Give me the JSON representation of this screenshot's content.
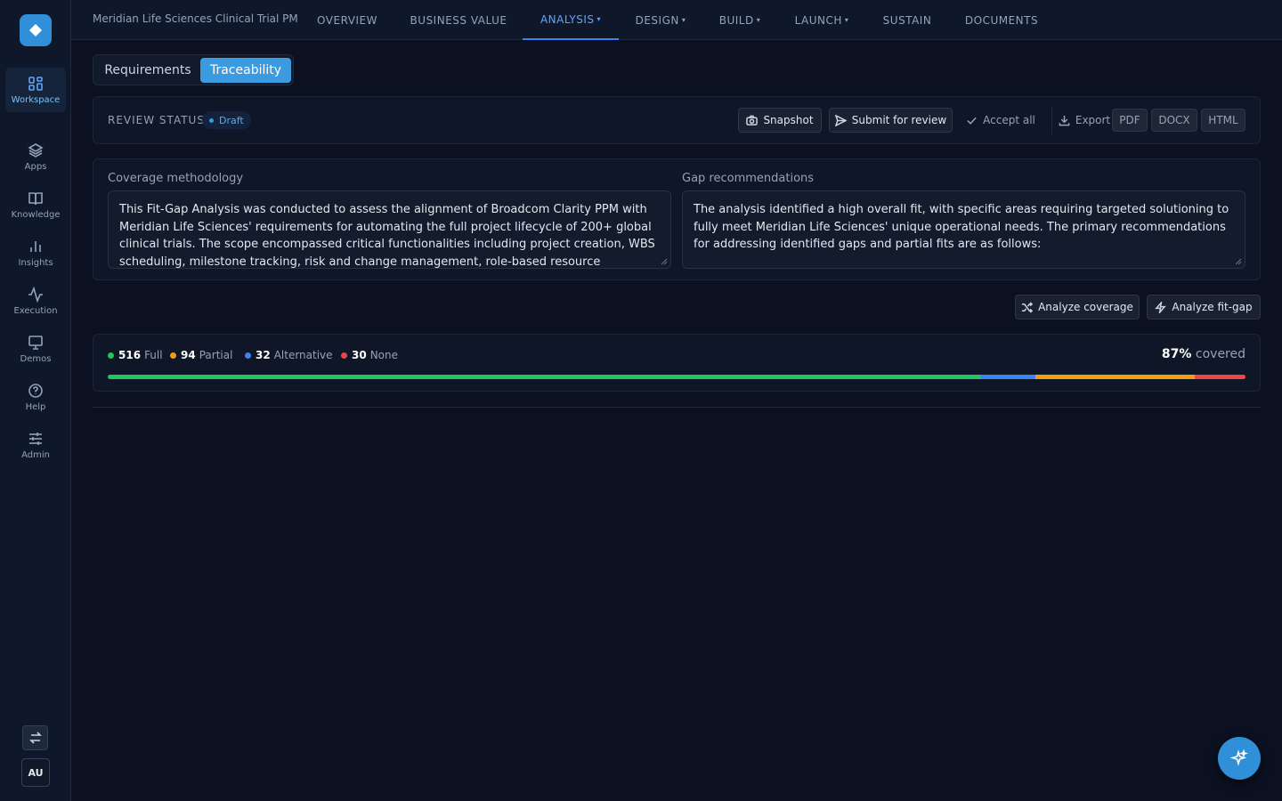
{
  "sidebar": {
    "items": [
      {
        "label": "Workspace",
        "icon": "grid-icon"
      },
      {
        "label": "Apps",
        "icon": "layers-icon"
      },
      {
        "label": "Knowledge",
        "icon": "book-icon"
      },
      {
        "label": "Insights",
        "icon": "bar-chart-icon"
      },
      {
        "label": "Execution",
        "icon": "activity-icon"
      },
      {
        "label": "Demos",
        "icon": "presentation-icon"
      },
      {
        "label": "Help",
        "icon": "help-circle-icon"
      },
      {
        "label": "Admin",
        "icon": "sliders-icon"
      }
    ],
    "active_item": "Workspace",
    "avatar": "AU"
  },
  "header": {
    "project": "Meridian Life Sciences Clinical Trial PM",
    "tabs": [
      {
        "label": "OVERVIEW",
        "caret": ""
      },
      {
        "label": "BUSINESS VALUE",
        "caret": ""
      },
      {
        "label": "ANALYSIS",
        "caret": "▾"
      },
      {
        "label": "DESIGN",
        "caret": "▾"
      },
      {
        "label": "BUILD",
        "caret": "▾"
      },
      {
        "label": "LAUNCH",
        "caret": "▾"
      },
      {
        "label": "SUSTAIN",
        "caret": ""
      },
      {
        "label": "DOCUMENTS",
        "caret": ""
      }
    ],
    "active_tab": "ANALYSIS"
  },
  "view_toggle": {
    "options": [
      "Requirements",
      "Traceability"
    ],
    "selected": "Traceability"
  },
  "review": {
    "label": "REVIEW STATUS",
    "status": "Draft",
    "snapshot": "Snapshot",
    "submit": "Submit for review",
    "accept_all": "Accept all",
    "export": "Export",
    "formats": [
      "PDF",
      "DOCX",
      "HTML"
    ]
  },
  "methodology": {
    "label": "Coverage methodology",
    "text": "This Fit-Gap Analysis was conducted to assess the alignment of Broadcom Clarity PPM with Meridian Life Sciences' requirements for automating the full project lifecycle of 200+ global clinical trials. The scope encompassed critical functionalities including project creation, WBS scheduling, milestone tracking, risk and change management, role-based resource provisioning, and PM dashboards,"
  },
  "recommendations": {
    "label": "Gap recommendations",
    "text": "The analysis identified a high overall fit, with specific areas requiring targeted solutioning to fully meet Meridian Life Sciences' unique operational needs. The primary recommendations for addressing identified gaps and partial fits are as follows:"
  },
  "actions": {
    "analyze_coverage": "Analyze coverage",
    "analyze_fitgap": "Analyze fit-gap"
  },
  "coverage": {
    "stats": [
      {
        "count": "516",
        "label": "Full",
        "color": "#22c55e"
      },
      {
        "count": "94",
        "label": "Partial",
        "color": "#f59e0b"
      },
      {
        "count": "32",
        "label": "Alternative",
        "color": "#3b82f6"
      },
      {
        "count": "30",
        "label": "None",
        "color": "#ef4444"
      }
    ],
    "percent": "87%",
    "covered_label": "covered",
    "bar_segments": [
      {
        "name": "Full",
        "value": 516,
        "color": "#22c55e"
      },
      {
        "name": "Alternative",
        "value": 32,
        "color": "#3b82f6"
      },
      {
        "name": "Partial",
        "value": 94,
        "color": "#f59e0b"
      },
      {
        "name": "None",
        "value": 30,
        "color": "#ef4444"
      }
    ]
  },
  "colors": {
    "accent": "#3b9ae0",
    "background": "#0b1120"
  }
}
